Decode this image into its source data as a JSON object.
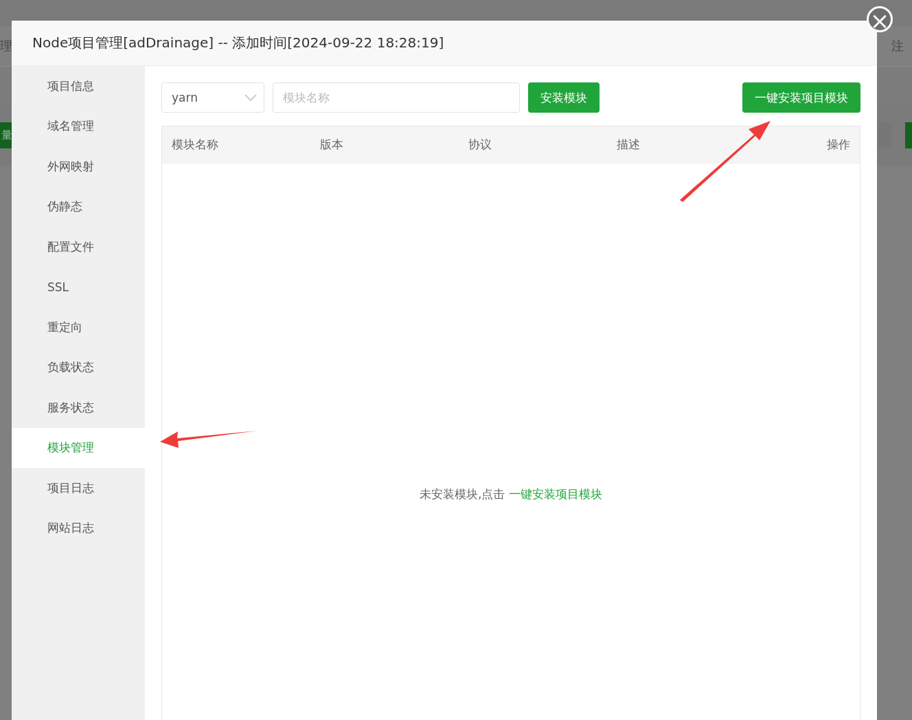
{
  "background": {
    "header_left": "理",
    "header_right": "注",
    "button_left": "量"
  },
  "modal": {
    "title": "Node项目管理[adDrainage] -- 添加时间[2024-09-22 18:28:19]",
    "close": "×"
  },
  "sidebar": {
    "items": [
      {
        "label": "项目信息",
        "selected": false
      },
      {
        "label": "域名管理",
        "selected": false
      },
      {
        "label": "外网映射",
        "selected": false
      },
      {
        "label": "伪静态",
        "selected": false
      },
      {
        "label": "配置文件",
        "selected": false
      },
      {
        "label": "SSL",
        "selected": false
      },
      {
        "label": "重定向",
        "selected": false
      },
      {
        "label": "负载状态",
        "selected": false
      },
      {
        "label": "服务状态",
        "selected": false
      },
      {
        "label": "模块管理",
        "selected": true
      },
      {
        "label": "项目日志",
        "selected": false
      },
      {
        "label": "网站日志",
        "selected": false
      }
    ]
  },
  "toolbar": {
    "package_manager": "yarn",
    "module_name": {
      "placeholder": "模块名称"
    },
    "install_button": "安装模块",
    "install_all_button": "一键安装项目模块"
  },
  "table": {
    "columns": [
      "模块名称",
      "版本",
      "协议",
      "描述",
      "操作"
    ],
    "empty_message": {
      "text": "未安装模块,点击 ",
      "link": "一键安装项目模块"
    }
  }
}
